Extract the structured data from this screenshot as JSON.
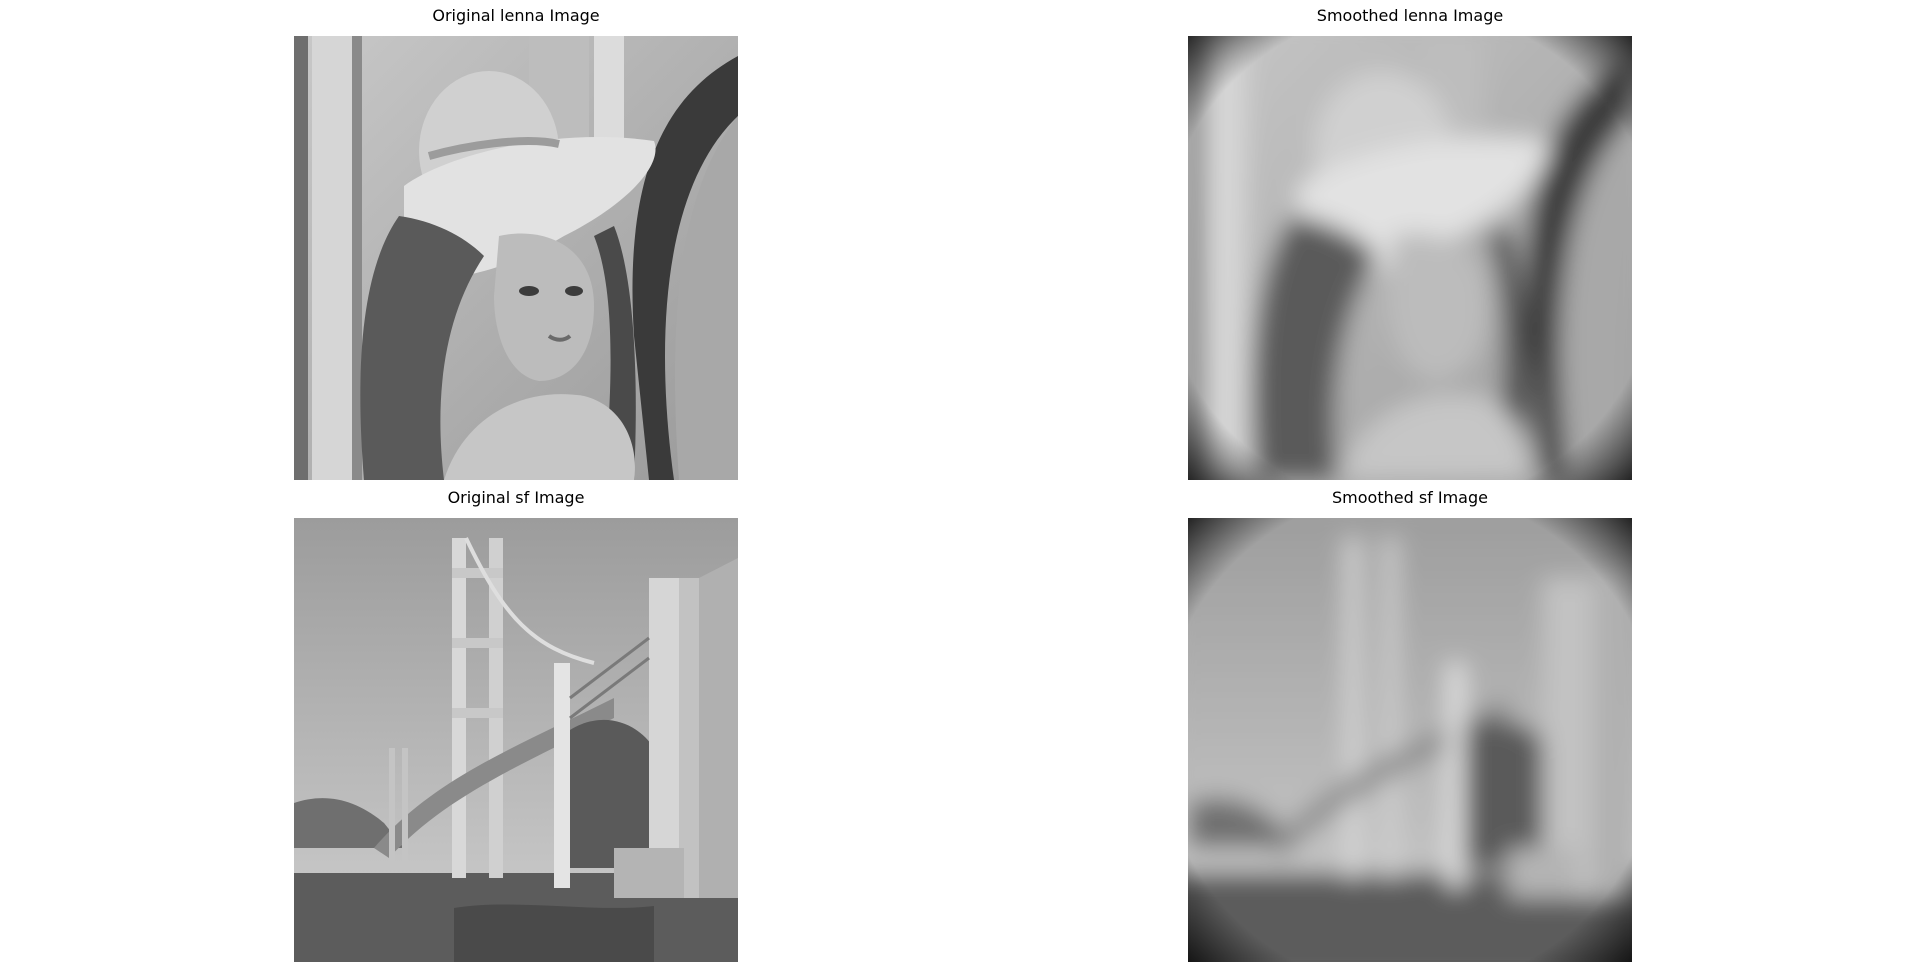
{
  "figure": {
    "panels": [
      {
        "title": "Original lenna Image",
        "image": "lenna-grayscale",
        "processing": "none"
      },
      {
        "title": "Smoothed lenna Image",
        "image": "lenna-grayscale",
        "processing": "box-smoothed"
      },
      {
        "title": "Original sf Image",
        "image": "golden-gate-bridge-grayscale",
        "processing": "none"
      },
      {
        "title": "Smoothed sf Image",
        "image": "golden-gate-bridge-grayscale",
        "processing": "box-smoothed"
      }
    ]
  },
  "colors": {
    "background": "#ffffff",
    "title_text": "#000000"
  }
}
